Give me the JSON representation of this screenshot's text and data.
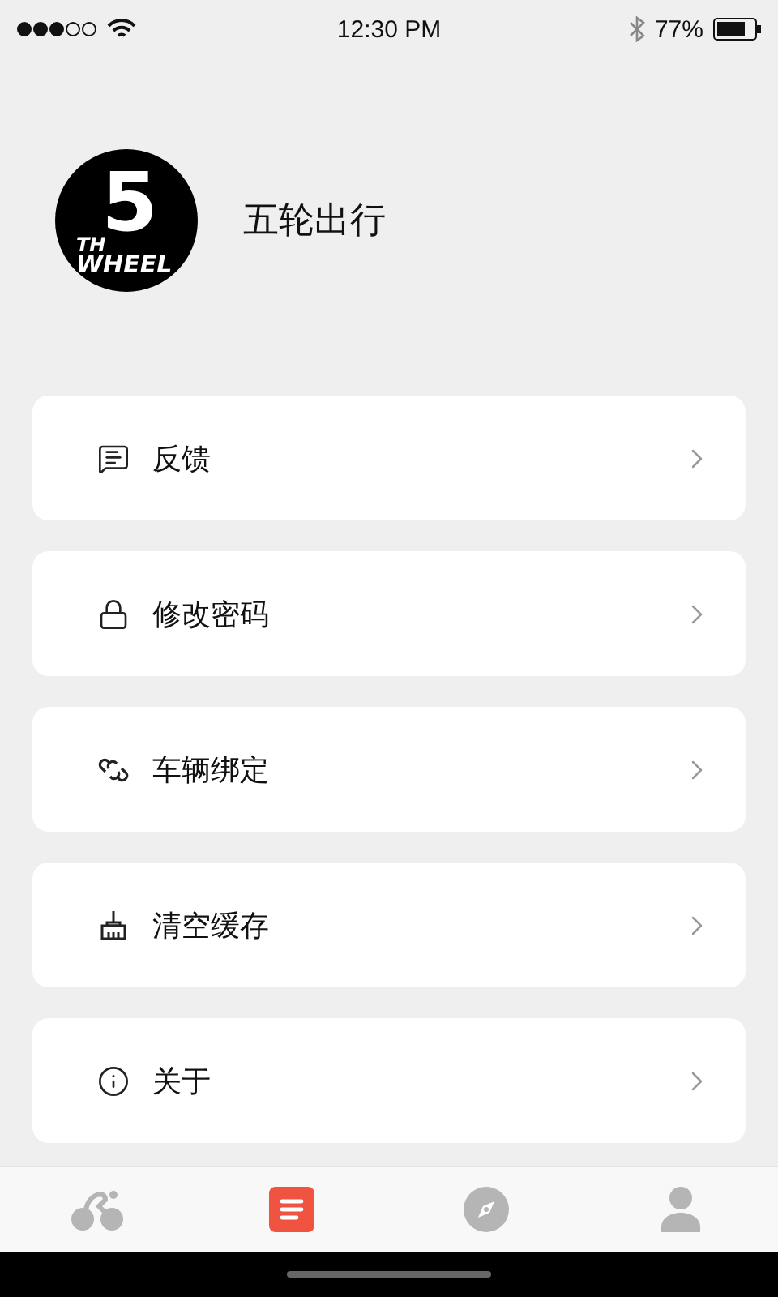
{
  "status_bar": {
    "time": "12:30 PM",
    "battery": "77%"
  },
  "profile": {
    "logo": {
      "numeral": "5",
      "line1": "TH",
      "line2": "WHEEL"
    },
    "name": "五轮出行"
  },
  "menu": [
    {
      "kind": "feedback",
      "label": "反馈"
    },
    {
      "kind": "password",
      "label": "修改密码"
    },
    {
      "kind": "binding",
      "label": "车辆绑定"
    },
    {
      "kind": "cache",
      "label": "清空缓存"
    },
    {
      "kind": "about",
      "label": "关于"
    }
  ],
  "tab_bar": [
    {
      "kind": "ride",
      "selected": false
    },
    {
      "kind": "list",
      "selected": true
    },
    {
      "kind": "discover",
      "selected": false
    },
    {
      "kind": "profile",
      "selected": false
    }
  ]
}
